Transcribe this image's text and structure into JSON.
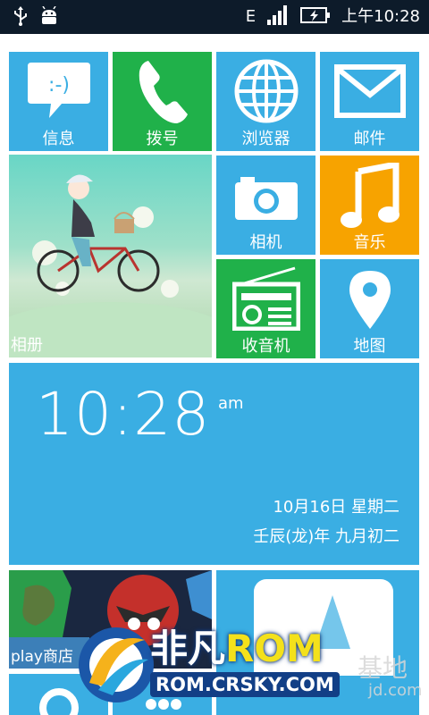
{
  "status_bar": {
    "network": "E",
    "time": "上午10:28",
    "icons": [
      "usb-icon",
      "android-debug-icon",
      "signal-icon",
      "battery-icon"
    ]
  },
  "tiles": {
    "messages": "信息",
    "dialer": "拨号",
    "browser": "浏览器",
    "mail": "邮件",
    "album": "相册",
    "camera": "相机",
    "music": "音乐",
    "radio": "收音机",
    "map": "地图",
    "store": "play商店"
  },
  "clock": {
    "time": "10:28",
    "ampm": "am",
    "date": "10月16日  星期二",
    "lunar": "壬辰(龙)年  九月初二"
  },
  "watermark": {
    "brand": "非凡",
    "rom": "ROM",
    "site": "ROM.CRSKY.COM",
    "right_text": "基地",
    "right_site": "jd.com"
  },
  "colors": {
    "tile_blue": "#3aaee3",
    "tile_green": "#20b14a",
    "tile_orange": "#f7a300",
    "status_bg": "#0d1b2a"
  }
}
